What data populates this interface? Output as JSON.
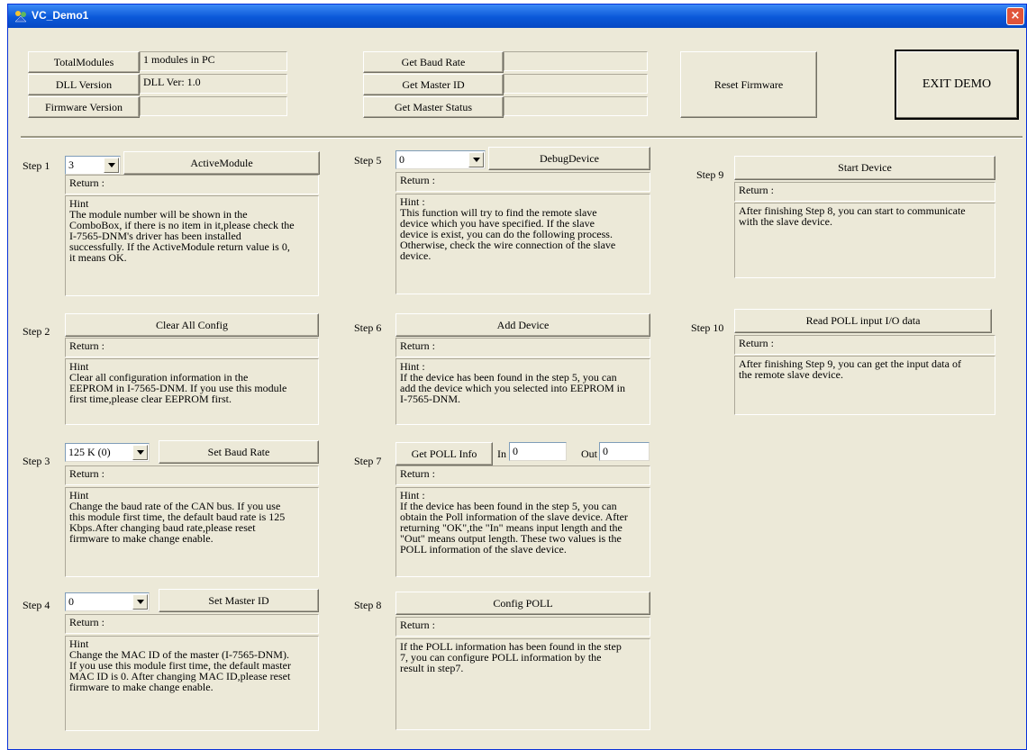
{
  "window": {
    "title": "VC_Demo1",
    "close_glyph": "×",
    "icon": "app-icon"
  },
  "top": {
    "total_modules_btn": "TotalModules",
    "total_modules_val": "1 modules in PC",
    "dll_version_btn": "DLL Version",
    "dll_version_val": "DLL Ver: 1.0",
    "firmware_version_btn": "Firmware Version",
    "firmware_version_val": "",
    "baud_rate_btn": "Get Baud Rate",
    "baud_rate_val": "",
    "master_id_btn": "Get Master ID",
    "master_id_val": "",
    "master_status_btn": "Get Master Status",
    "master_status_val": "",
    "reset_firmware_btn": "Reset Firmware",
    "exit_btn": "EXIT DEMO"
  },
  "common": {
    "return_label": "Return :"
  },
  "steps": {
    "s1": {
      "label": "Step 1",
      "combo": "3",
      "button": "ActiveModule",
      "hint": "Hint\nThe module number will be shown in the\nComboBox, if there is no item in it,please check the\nI-7565-DNM's driver has been installed\nsuccessfully. If the ActiveModule return value is 0,\nit means OK."
    },
    "s2": {
      "label": "Step 2",
      "button": "Clear All Config",
      "hint": "Hint\nClear all configuration information in the\nEEPROM in I-7565-DNM. If you use this module\nfirst time,please clear EEPROM first."
    },
    "s3": {
      "label": "Step 3",
      "combo": "125 K (0)",
      "button": "Set Baud Rate",
      "hint": "Hint\nChange the baud rate of the CAN bus. If you use\nthis module first time, the default baud rate is 125\nKbps.After changing baud rate,please reset\nfirmware to make change enable."
    },
    "s4": {
      "label": "Step 4",
      "combo": "0",
      "button": "Set Master ID",
      "hint": "Hint\nChange the MAC ID of the master (I-7565-DNM).\nIf you use this module first time, the default master\nMAC ID is 0. After changing MAC ID,please reset\nfirmware to make change enable."
    },
    "s5": {
      "label": "Step 5",
      "combo": "0",
      "button": "DebugDevice",
      "hint": "Hint :\nThis function will try to find the remote slave\ndevice which you have specified. If the slave\ndevice is exist, you can do the following process.\nOtherwise, check the wire connection of the slave\ndevice."
    },
    "s6": {
      "label": "Step 6",
      "button": "Add Device",
      "hint": "Hint :\nIf the device has been found in the step 5, you can\nadd the device which you selected into EEPROM in\nI-7565-DNM."
    },
    "s7": {
      "label": "Step 7",
      "button": "Get POLL Info",
      "in_label": "In",
      "in_val": "0",
      "out_label": "Out",
      "out_val": "0",
      "hint": "Hint :\nIf the device has been found in the step 5, you can\nobtain the Poll information of the slave device. After\nreturning \"OK\",the \"In\" means input length and the\n\"Out\" means output length. These two values is the\nPOLL information of the slave device."
    },
    "s8": {
      "label": "Step 8",
      "button": "Config POLL",
      "hint": "If the POLL information has been found in the step\n7, you can configure POLL information by the\nresult in step7."
    },
    "s9": {
      "label": "Step 9",
      "button": "Start Device",
      "hint": "After finishing Step 8, you can start to communicate\nwith the slave device."
    },
    "s10": {
      "label": "Step 10",
      "button": "Read POLL input I/O data",
      "hint": "After finishing Step 9, you can get the input data of\nthe remote slave device."
    }
  }
}
